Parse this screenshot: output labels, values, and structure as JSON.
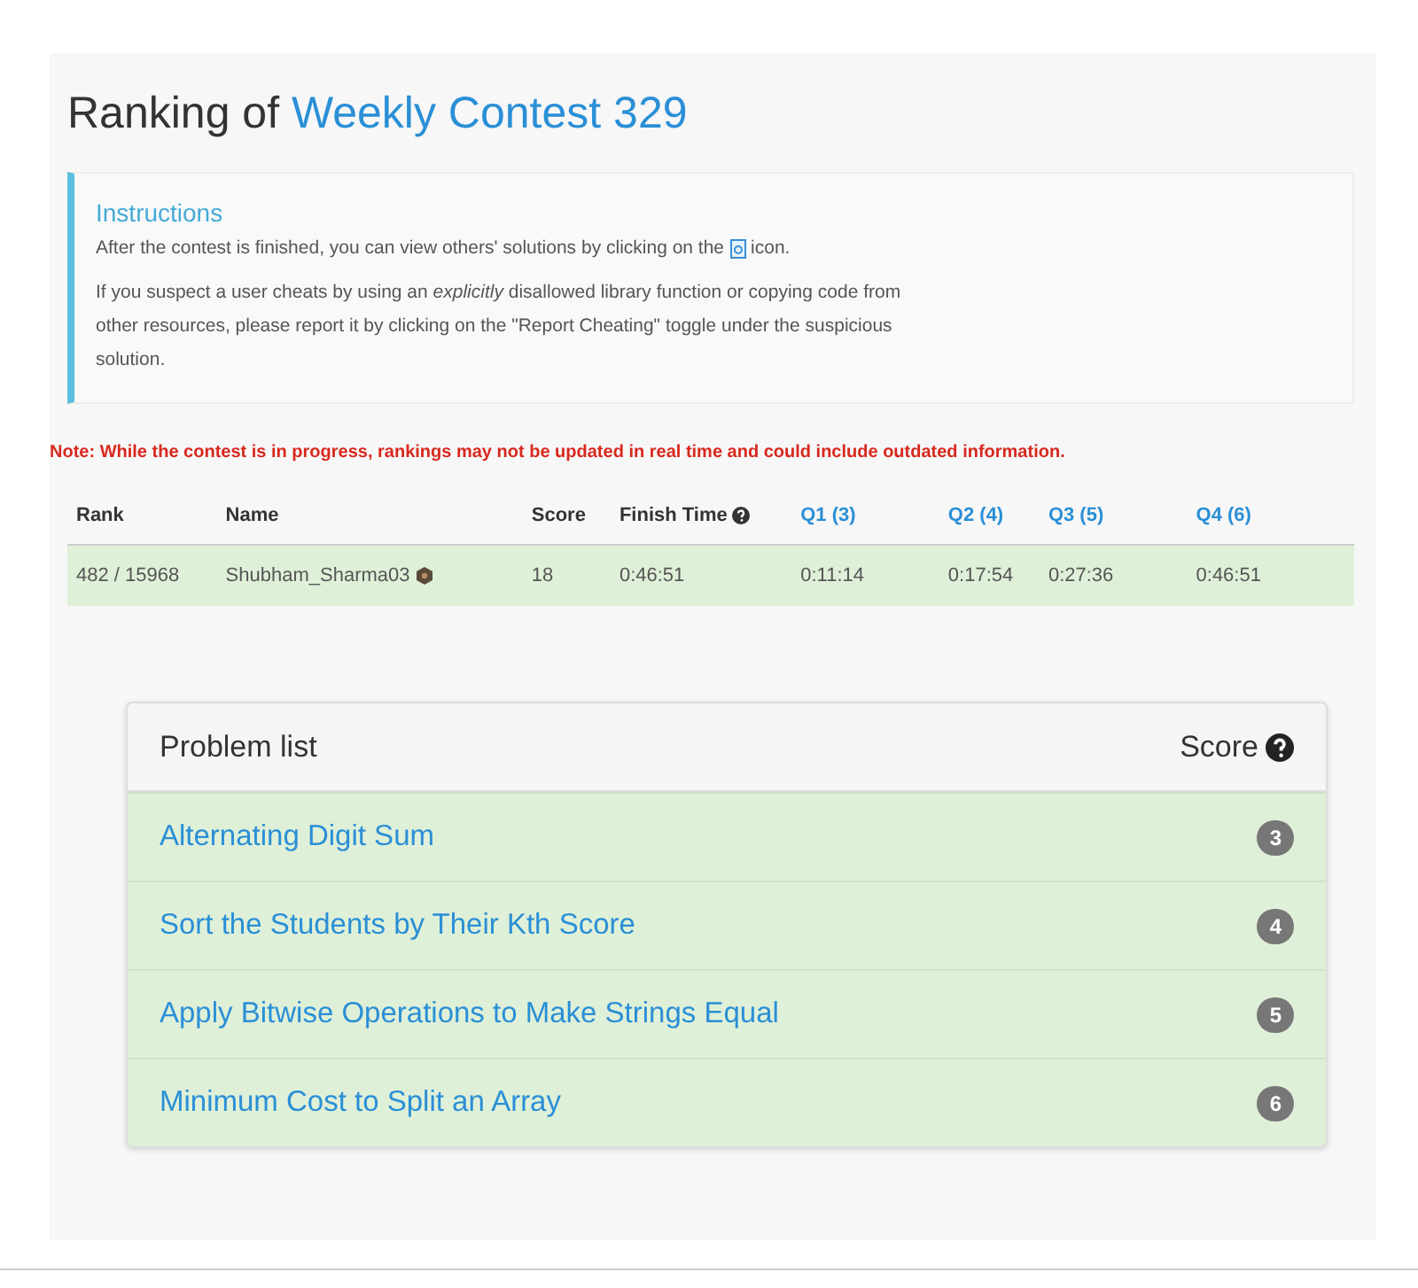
{
  "title": {
    "prefix": "Ranking of",
    "contest": "Weekly Contest 329"
  },
  "instructions": {
    "heading": "Instructions",
    "line_before_icon": "After the contest is finished, you can view others' solutions by clicking on the",
    "line_after_icon": "icon.",
    "paragraph": "If you suspect a user cheats by using an *explicitly* disallowed library function or copying code from other resources, please report it by clicking on the \"Report Cheating\" toggle under the suspicious solution."
  },
  "note": "Note: While the contest is in progress, rankings may not be updated in real time and could include outdated information.",
  "ranking": {
    "columns": [
      {
        "label": "Rank",
        "kind": "plain"
      },
      {
        "label": "Name",
        "kind": "plain"
      },
      {
        "label": "Score",
        "kind": "plain"
      },
      {
        "label": "Finish Time",
        "kind": "help"
      },
      {
        "label": "Q1 (3)",
        "kind": "link"
      },
      {
        "label": "Q2 (4)",
        "kind": "link"
      },
      {
        "label": "Q3 (5)",
        "kind": "link"
      },
      {
        "label": "Q4 (6)",
        "kind": "link"
      }
    ],
    "rows": [
      {
        "cells": [
          "482 / 15968",
          "Shubham_Sharma03",
          "18",
          "0:46:51",
          "0:11:14",
          "0:17:54",
          "0:27:36",
          "0:46:51"
        ]
      }
    ]
  },
  "problem_list": {
    "title": "Problem list",
    "score_label": "Score",
    "problems": [
      {
        "name": "Alternating Digit Sum",
        "score": "3"
      },
      {
        "name": "Sort the Students by Their Kth Score",
        "score": "4"
      },
      {
        "name": "Apply Bitwise Operations to Make Strings Equal",
        "score": "5"
      },
      {
        "name": "Minimum Cost to Split an Array",
        "score": "6"
      }
    ]
  }
}
